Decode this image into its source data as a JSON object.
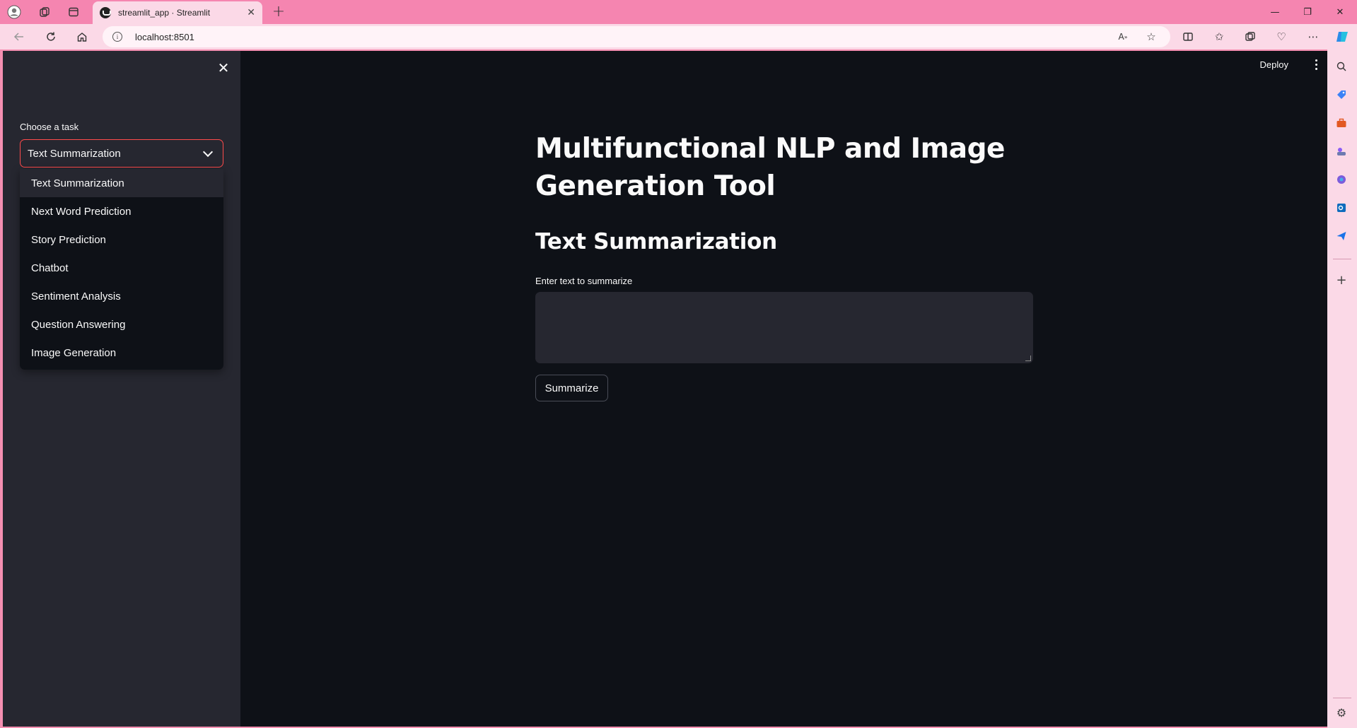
{
  "browser": {
    "tab_title": "streamlit_app · Streamlit",
    "url": "localhost:8501",
    "tab_close": "✕",
    "new_tab": "+",
    "window_controls": [
      "—",
      "❐",
      "✕"
    ]
  },
  "app": {
    "deploy_label": "Deploy",
    "sidebar": {
      "select_label": "Choose a task",
      "selected": "Text Summarization",
      "options": [
        "Text Summarization",
        "Next Word Prediction",
        "Story Prediction",
        "Chatbot",
        "Sentiment Analysis",
        "Question Answering",
        "Image Generation"
      ]
    },
    "main": {
      "title": "Multifunctional NLP and Image Generation Tool",
      "section_title": "Text Summarization",
      "textarea_label": "Enter text to summarize",
      "textarea_value": "",
      "button_label": "Summarize"
    }
  },
  "colors": {
    "browser_accent": "#f585b0",
    "app_bg": "#0e1117",
    "sidebar_bg": "#262730",
    "focus_border": "#ff4b4b"
  }
}
